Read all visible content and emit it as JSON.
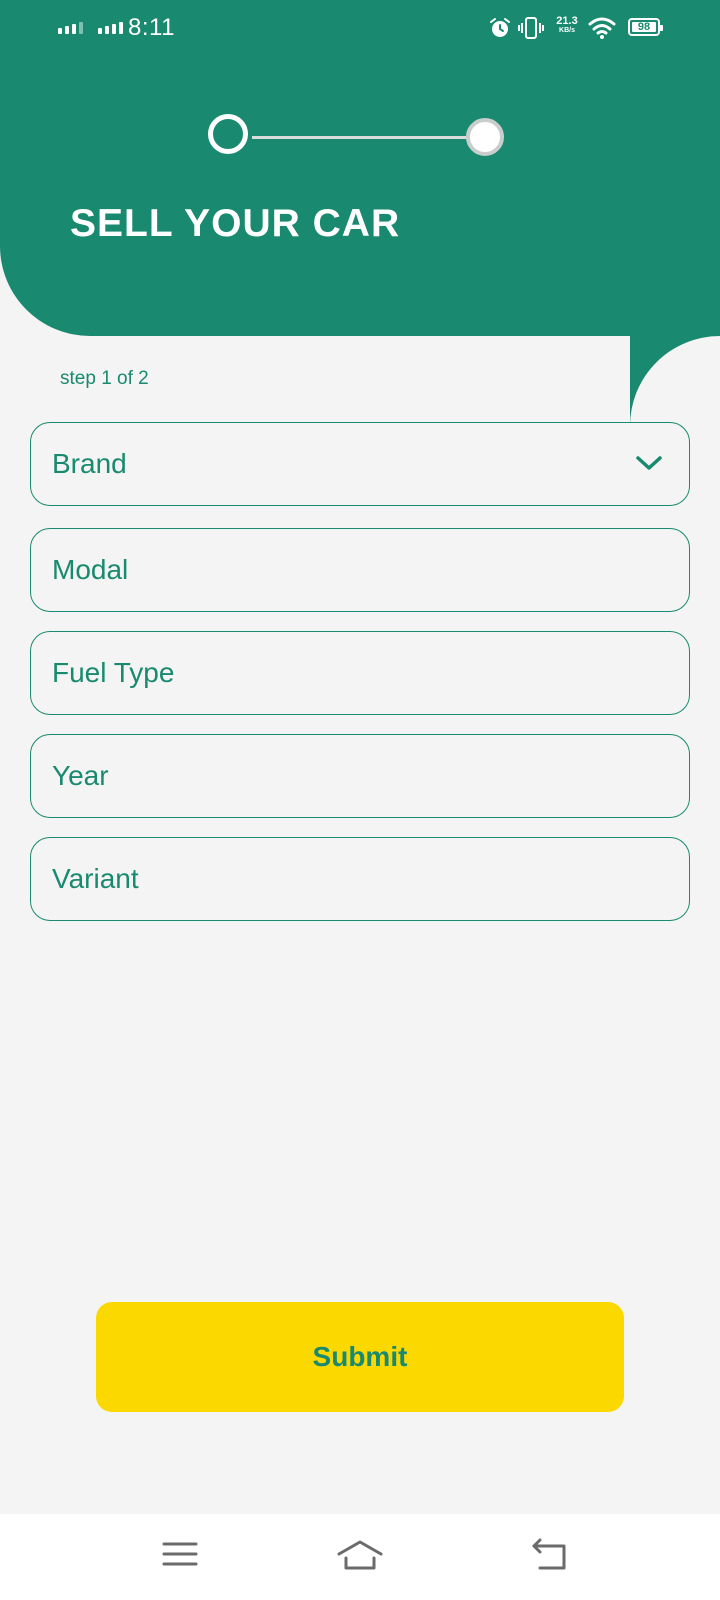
{
  "status_bar": {
    "time": "8:11",
    "net_speed_value": "21.3",
    "net_speed_unit": "KB/s",
    "battery": "98",
    "icons": [
      "signal-icon",
      "signal-icon",
      "alarm-icon",
      "vibrate-icon",
      "wifi-icon",
      "battery-icon"
    ]
  },
  "header": {
    "title": "SELL YOUR CAR",
    "steps_total": 2,
    "current_step": 1
  },
  "form": {
    "step_label": "step 1 of 2",
    "fields": [
      {
        "label": "Brand",
        "type": "dropdown"
      },
      {
        "label": "Modal",
        "type": "text"
      },
      {
        "label": "Fuel Type",
        "type": "text"
      },
      {
        "label": "Year",
        "type": "text"
      },
      {
        "label": "Variant",
        "type": "text"
      }
    ],
    "submit_label": "Submit"
  },
  "nav_bar": {
    "icons": [
      "menu-icon",
      "home-icon",
      "back-icon"
    ]
  },
  "colors": {
    "primary": "#198a6f",
    "accent": "#fbd800",
    "background": "#f3f4f3"
  }
}
